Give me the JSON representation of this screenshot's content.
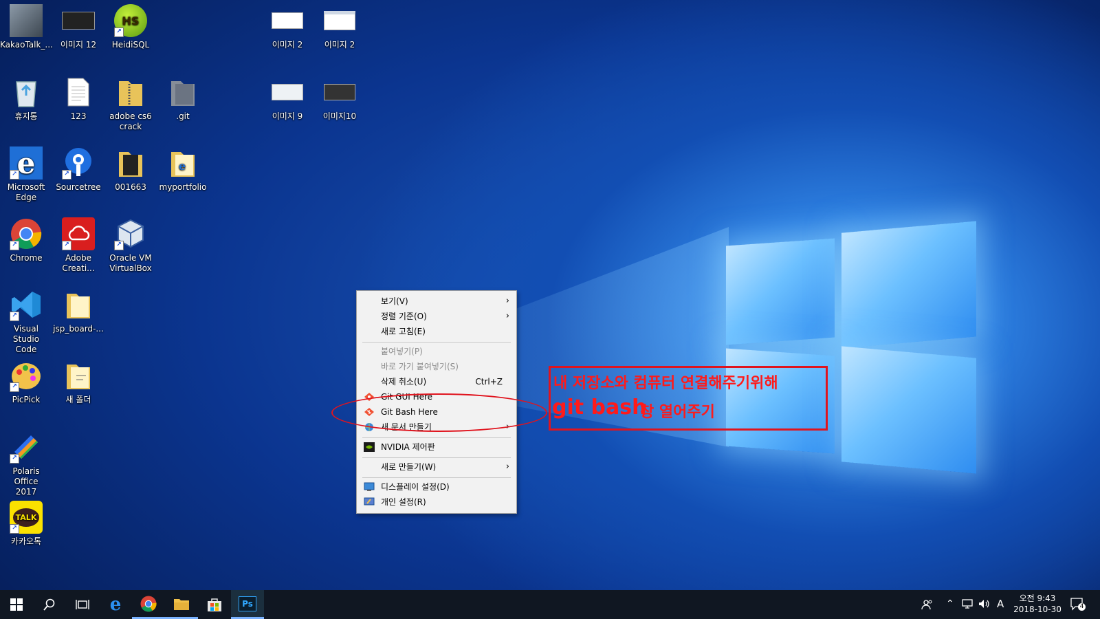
{
  "desktop_icons": [
    {
      "label": "KakaoTalk_..."
    },
    {
      "label": "이미지 12"
    },
    {
      "label": "HeidiSQL"
    },
    {
      "label": "이미지 2"
    },
    {
      "label": "이미지 2"
    },
    {
      "label": "휴지통"
    },
    {
      "label": "123"
    },
    {
      "label": "adobe cs6\ncrack"
    },
    {
      "label": ".git"
    },
    {
      "label": "이미지 9"
    },
    {
      "label": "이미지10"
    },
    {
      "label": "Microsoft\nEdge"
    },
    {
      "label": "Sourcetree"
    },
    {
      "label": "001663"
    },
    {
      "label": "myportfolio"
    },
    {
      "label": "Chrome"
    },
    {
      "label": "Adobe\nCreati..."
    },
    {
      "label": "Oracle VM\nVirtualBox"
    },
    {
      "label": "Visual Studio\nCode"
    },
    {
      "label": "jsp_board-..."
    },
    {
      "label": "PicPick"
    },
    {
      "label": "새 폴더"
    },
    {
      "label": "Polaris Office\n2017"
    },
    {
      "label": "카카오톡"
    }
  ],
  "icon_glyphs": {
    "heidisql": "HS",
    "edge": "e",
    "kakaotalk": "TALK",
    "photoshop": "Ps"
  },
  "context_menu": {
    "view": "보기(V)",
    "sort_by": "정렬 기준(O)",
    "refresh": "새로 고침(E)",
    "paste": "붙여넣기(P)",
    "paste_shortcut": "바로 가기 붙여넣기(S)",
    "undo_delete": "삭제 취소(U)",
    "undo_shortcut": "Ctrl+Z",
    "git_gui": "Git GUI Here",
    "git_bash": "Git Bash Here",
    "new_doc": "새 문서 만들기",
    "nvidia": "NVIDIA 제어판",
    "new": "새로 만들기(W)",
    "display": "디스플레이 설정(D)",
    "personalize": "개인 설정(R)"
  },
  "annotation": {
    "line1": "내 저장소와 컴퓨터 연결해주기위해",
    "line2_bold": "git bash",
    "line2_rest": "창 열어주기",
    "color": "#e0141e"
  },
  "taskbar": {
    "time": "오전 9:43",
    "date": "2018-10-30",
    "ime": "A",
    "notification_count": "4"
  }
}
